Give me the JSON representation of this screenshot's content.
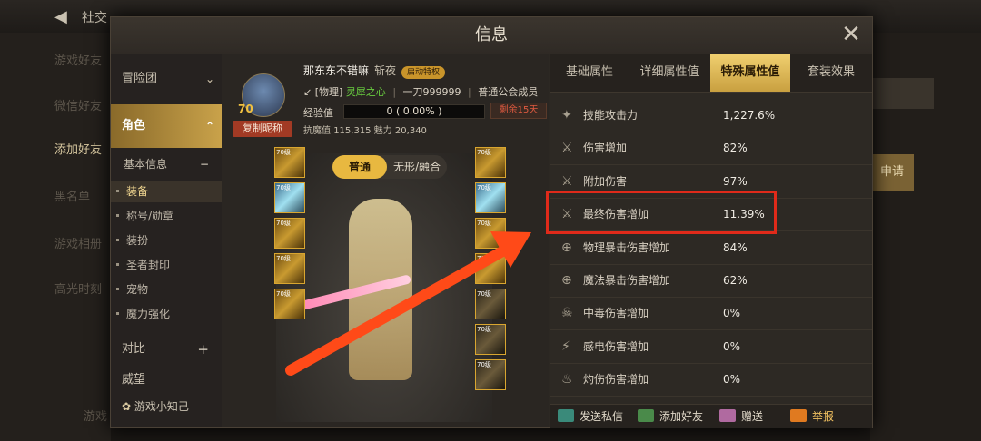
{
  "background": {
    "top_title": "社交",
    "left_items": [
      "游戏好友",
      "微信好友",
      "添加好友",
      "黑名单",
      "游戏相册",
      "高光时刻",
      "游戏"
    ],
    "right_button": "申请"
  },
  "modal": {
    "title": "信息",
    "close_icon": "close-icon"
  },
  "nav": {
    "group1": "冒险团",
    "group2": "角色",
    "basic_info": "基本信息",
    "items": [
      "装备",
      "称号/勋章",
      "装扮",
      "圣者封印",
      "宠物",
      "魔力强化"
    ],
    "compare": "对比",
    "prestige": "威望",
    "bottom": "游戏小知己"
  },
  "character": {
    "name": "那东东不错嘛",
    "class": "斩夜",
    "badge": "启动特权",
    "level": "70",
    "copy_button": "复制昵称",
    "type_tag": "[物理]",
    "spirit": "灵犀之心",
    "guild_title": "一刀999999",
    "guild_member": "普通公会成员",
    "exp_label": "经验值",
    "exp_value": "0 ( 0.00% )",
    "remaining": "剩余15天",
    "magic_resist_label": "抗魔值",
    "magic_resist": "115,315",
    "charm_label": "魅力",
    "charm": "20,340",
    "mode_normal": "普通",
    "mode_fusion": "无形/融合",
    "slot_level": "70级"
  },
  "tabs": [
    "基础属性",
    "详细属性值",
    "特殊属性值",
    "套装效果"
  ],
  "active_tab": 2,
  "attributes": [
    {
      "name": "技能攻击力",
      "value": "1,227.6%",
      "icon": "skill-attack-icon"
    },
    {
      "name": "伤害增加",
      "value": "82%",
      "icon": "crossed-swords-icon"
    },
    {
      "name": "附加伤害",
      "value": "97%",
      "icon": "crossed-swords-icon"
    },
    {
      "name": "最终伤害增加",
      "value": "11.39%",
      "icon": "crossed-swords-icon"
    },
    {
      "name": "物理暴击伤害增加",
      "value": "84%",
      "icon": "crosshair-icon"
    },
    {
      "name": "魔法暴击伤害增加",
      "value": "62%",
      "icon": "crosshair-icon"
    },
    {
      "name": "中毒伤害增加",
      "value": "0%",
      "icon": "poison-icon"
    },
    {
      "name": "感电伤害增加",
      "value": "0%",
      "icon": "lightning-icon"
    },
    {
      "name": "灼伤伤害增加",
      "value": "0%",
      "icon": "fire-icon"
    }
  ],
  "actions": {
    "message": "发送私信",
    "add_friend": "添加好友",
    "gift": "赠送",
    "report": "举报"
  },
  "colors": {
    "accent_gold": "#e8b840",
    "highlight_red": "#e02a1a",
    "arrow_orange": "#ff5a20"
  }
}
